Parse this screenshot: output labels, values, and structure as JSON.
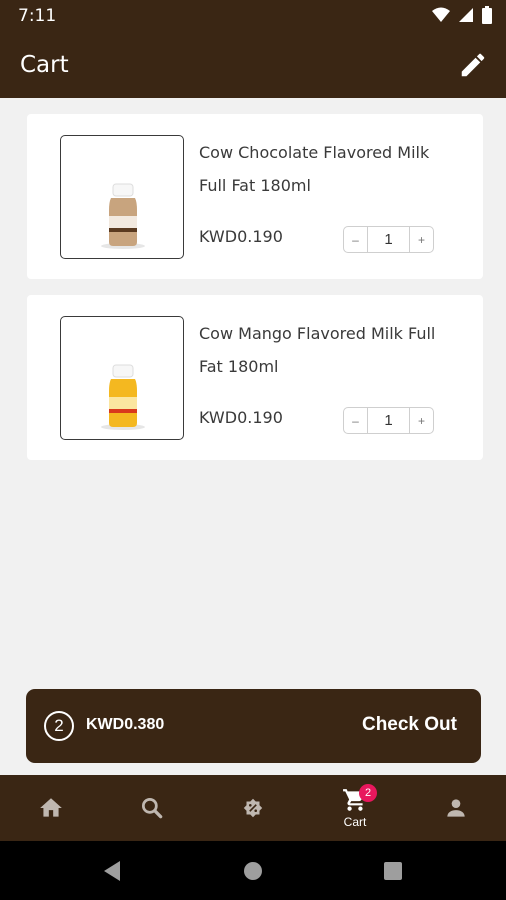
{
  "status_bar": {
    "time": "7:11"
  },
  "app_bar": {
    "title": "Cart"
  },
  "cart_items": [
    {
      "name": "Cow Chocolate Flavored Milk Full Fat 180ml",
      "price": "KWD0.190",
      "quantity": "1",
      "color": "#c8a47e"
    },
    {
      "name": "Cow Mango Flavored Milk Full Fat 180ml",
      "price": "KWD0.190",
      "quantity": "1",
      "color": "#f4b820"
    }
  ],
  "stepper": {
    "minus": "–",
    "plus": "+"
  },
  "checkout": {
    "count": "2",
    "total": "KWD0.380",
    "label": "Check Out"
  },
  "bottom_nav": {
    "items": [
      "home-icon",
      "search-icon",
      "offers-icon",
      "cart-icon",
      "profile-icon"
    ],
    "cart_label": "Cart",
    "cart_badge": "2"
  },
  "colors": {
    "brand": "#3a2614",
    "badge": "#e8175d",
    "background": "#f1f1f1"
  }
}
